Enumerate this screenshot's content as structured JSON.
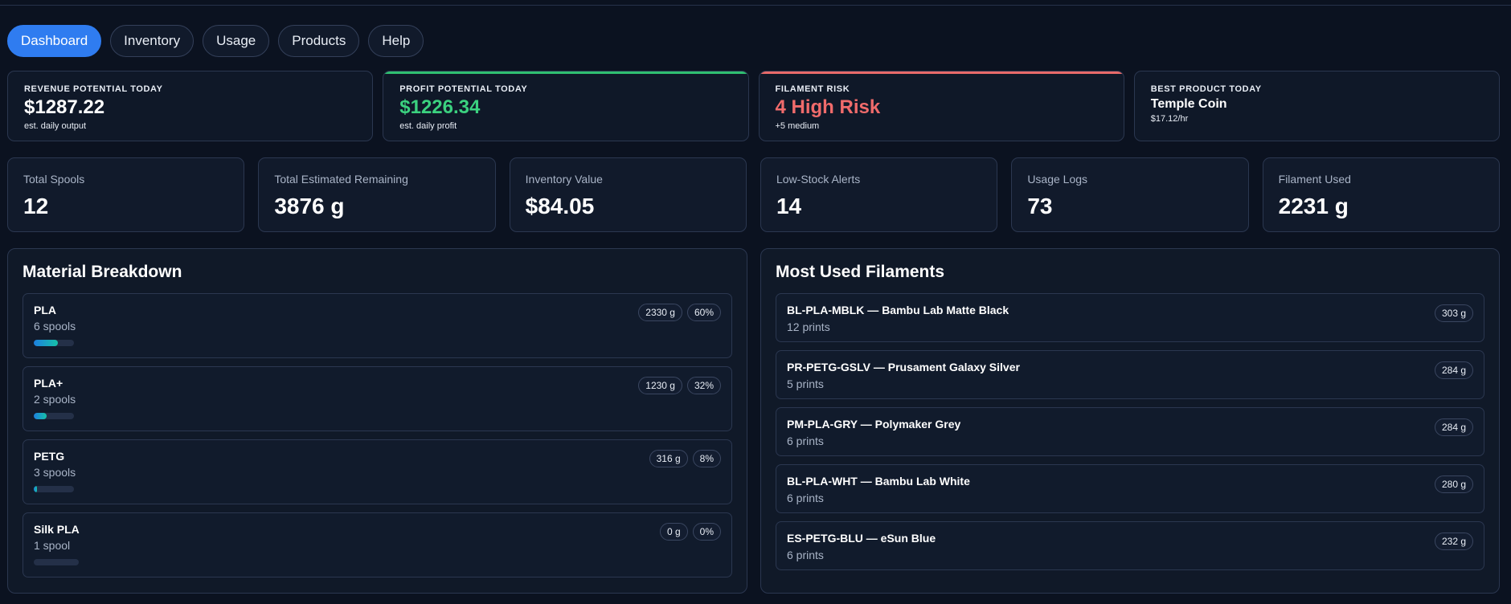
{
  "nav": [
    {
      "label": "Dashboard",
      "active": true
    },
    {
      "label": "Inventory",
      "active": false
    },
    {
      "label": "Usage",
      "active": false
    },
    {
      "label": "Products",
      "active": false
    },
    {
      "label": "Help",
      "active": false
    }
  ],
  "kpis": {
    "revenue": {
      "label": "REVENUE POTENTIAL TODAY",
      "value": "$1287.22",
      "sub": "est. daily output"
    },
    "profit": {
      "label": "PROFIT POTENTIAL TODAY",
      "value": "$1226.34",
      "sub": "est. daily profit"
    },
    "risk": {
      "label": "FILAMENT RISK",
      "value": "4 High Risk",
      "sub": "+5 medium"
    },
    "best": {
      "label": "BEST PRODUCT TODAY",
      "value": "Temple Coin",
      "sub": "$17.12/hr"
    }
  },
  "colors": {
    "accent": "#2f7cf0",
    "profit": "#3bd17f",
    "risk": "#f06b6b"
  },
  "stats": [
    {
      "label": "Total Spools",
      "value": "12"
    },
    {
      "label": "Total Estimated Remaining",
      "value": "3876 g"
    },
    {
      "label": "Inventory Value",
      "value": "$84.05"
    },
    {
      "label": "Low-Stock Alerts",
      "value": "14"
    },
    {
      "label": "Usage Logs",
      "value": "73"
    },
    {
      "label": "Filament Used",
      "value": "2231 g"
    }
  ],
  "material_breakdown": {
    "title": "Material Breakdown",
    "items": [
      {
        "name": "PLA",
        "spools": "6 spools",
        "grams": "2330 g",
        "percent": "60%",
        "fraction": 0.6
      },
      {
        "name": "PLA+",
        "spools": "2 spools",
        "grams": "1230 g",
        "percent": "32%",
        "fraction": 0.32
      },
      {
        "name": "PETG",
        "spools": "3 spools",
        "grams": "316 g",
        "percent": "8%",
        "fraction": 0.08
      },
      {
        "name": "Silk PLA",
        "spools": "1 spool",
        "grams": "0 g",
        "percent": "0%",
        "fraction": 0
      }
    ]
  },
  "most_used": {
    "title": "Most Used Filaments",
    "items": [
      {
        "name": "BL-PLA-MBLK — Bambu Lab Matte Black",
        "prints": "12 prints",
        "grams": "303 g"
      },
      {
        "name": "PR-PETG-GSLV — Prusament Galaxy Silver",
        "prints": "5 prints",
        "grams": "284 g"
      },
      {
        "name": "PM-PLA-GRY — Polymaker Grey",
        "prints": "6 prints",
        "grams": "284 g"
      },
      {
        "name": "BL-PLA-WHT — Bambu Lab White",
        "prints": "6 prints",
        "grams": "280 g"
      },
      {
        "name": "ES-PETG-BLU — eSun Blue",
        "prints": "6 prints",
        "grams": "232 g"
      }
    ]
  }
}
